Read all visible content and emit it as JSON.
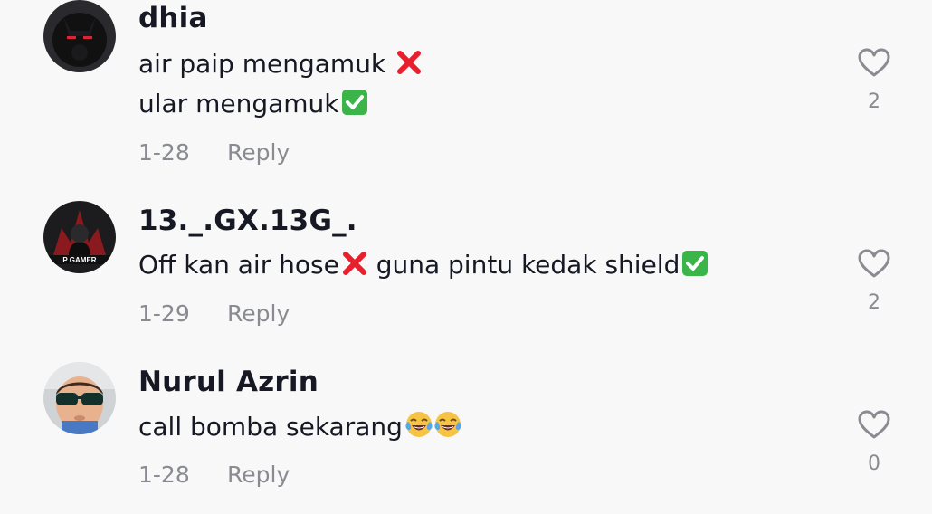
{
  "comments": [
    {
      "username": "dhia",
      "lines": [
        "air paip mengamuk",
        "ular mengamuk"
      ],
      "line_emojis": [
        "cross-mark-emoji",
        "check-mark-button-emoji"
      ],
      "date": "1-28",
      "reply_label": "Reply",
      "likes": "2",
      "avatar_icon": "dark-masked-figure-avatar"
    },
    {
      "username": "13._.GX.13G_.",
      "line_segments": [
        "Off kan air hose",
        " guna pintu kedak shield"
      ],
      "line_emojis": [
        "cross-mark-emoji",
        "check-mark-button-emoji"
      ],
      "avatar_text": "P GAMER",
      "date": "1-29",
      "reply_label": "Reply",
      "likes": "2",
      "avatar_icon": "gamer-logo-avatar"
    },
    {
      "username": "Nurul Azrin",
      "lines": [
        "call bomba sekarang"
      ],
      "line_emojis": [
        "face-with-tears-of-joy-emoji",
        "face-with-tears-of-joy-emoji"
      ],
      "date": "1-28",
      "reply_label": "Reply",
      "likes": "0",
      "avatar_icon": "child-with-sunglasses-avatar"
    }
  ],
  "colors": {
    "background": "#f8f8f8",
    "text_primary": "#161823",
    "text_secondary": "#8a8b91",
    "cross_mark": "#e8202e",
    "check_mark": "#3bb44a"
  },
  "icons": {
    "like": "heart-outline-icon"
  }
}
